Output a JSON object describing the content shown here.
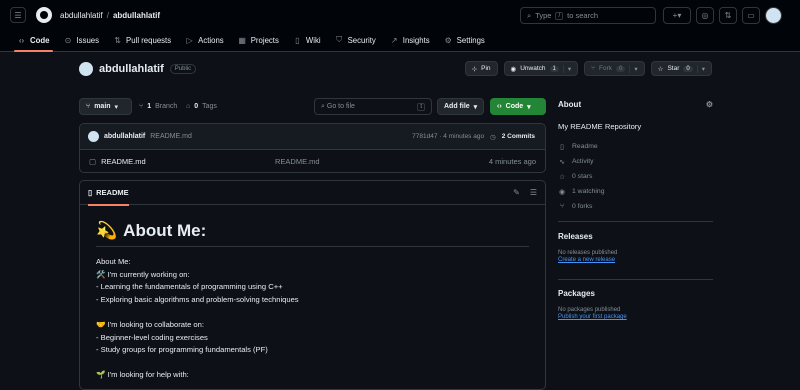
{
  "header": {
    "owner": "abdullahlatif",
    "separator": "/",
    "repo": "abdullahlatif",
    "search_placeholder": "Type",
    "search_kbd": "/",
    "search_suffix": "to search",
    "plus_label": "+",
    "menu_icon": "hamburger-icon"
  },
  "nav": {
    "tabs": [
      {
        "label": "Code",
        "icon": "code-icon"
      },
      {
        "label": "Issues",
        "icon": "issue-icon"
      },
      {
        "label": "Pull requests",
        "icon": "pull-request-icon"
      },
      {
        "label": "Actions",
        "icon": "play-icon"
      },
      {
        "label": "Projects",
        "icon": "table-icon"
      },
      {
        "label": "Wiki",
        "icon": "book-icon"
      },
      {
        "label": "Security",
        "icon": "shield-icon"
      },
      {
        "label": "Insights",
        "icon": "graph-icon"
      },
      {
        "label": "Settings",
        "icon": "gear-icon"
      }
    ]
  },
  "repo": {
    "name": "abdullahlatif",
    "visibility": "Public",
    "pin": "Pin",
    "watch": "Unwatch",
    "watch_count": "1",
    "fork": "Fork",
    "fork_count": "0",
    "star": "Star",
    "star_count": "0"
  },
  "toolbar": {
    "branch": "main",
    "branch_count": "1",
    "branch_label": "Branch",
    "tag_count": "0",
    "tag_label": "Tags",
    "goto_placeholder": "Go to file",
    "goto_kbd": "t",
    "add_file": "Add file",
    "code": "Code"
  },
  "commit": {
    "author": "abdullahlatif",
    "message": "README.md",
    "hash": "7781d47 · 4 minutes ago",
    "commits_label": "2 Commits"
  },
  "files": [
    {
      "name": "README.md",
      "message": "README.md",
      "date": "4 minutes ago"
    }
  ],
  "readme": {
    "tab": "README",
    "title": "About Me:",
    "lines": [
      "About Me:",
      "🛠️ I'm currently working on:",
      "- Learning the fundamentals of programming using C++",
      "- Exploring basic algorithms and problem-solving techniques",
      "",
      "🤝 I'm looking to collaborate on:",
      "- Beginner-level coding exercises",
      "- Study groups for programming fundamentals (PF)",
      "",
      "🌱 I'm looking for help with:"
    ]
  },
  "about": {
    "heading": "About",
    "description": "My README Repository",
    "items": [
      {
        "label": "Readme",
        "icon": "book-icon"
      },
      {
        "label": "Activity",
        "icon": "pulse-icon"
      },
      {
        "label": "0 stars",
        "icon": "star-icon"
      },
      {
        "label": "1 watching",
        "icon": "eye-icon"
      },
      {
        "label": "0 forks",
        "icon": "fork-icon"
      }
    ]
  },
  "releases": {
    "heading": "Releases",
    "text": "No releases published",
    "link": "Create a new release"
  },
  "packages": {
    "heading": "Packages",
    "text": "No packages published",
    "link": "Publish your first package"
  },
  "colors": {
    "accent": "#f78166",
    "code_button": "#238636",
    "link": "#4493f8"
  }
}
